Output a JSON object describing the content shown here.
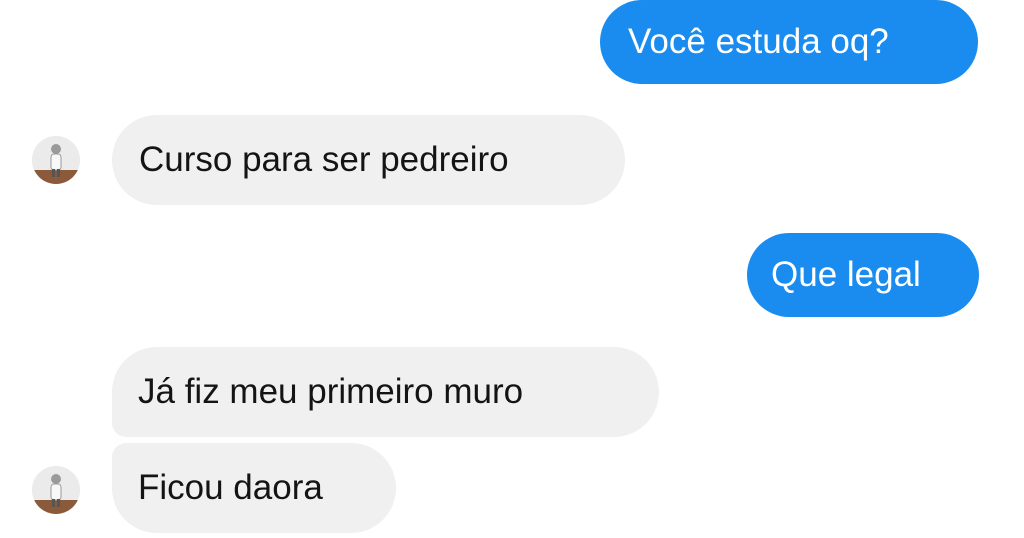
{
  "messages": [
    {
      "direction": "outgoing",
      "text": "Você estuda oq?"
    },
    {
      "direction": "incoming",
      "text": "Curso para ser pedreiro"
    },
    {
      "direction": "outgoing",
      "text": "Que legal"
    },
    {
      "direction": "incoming",
      "text": "Já fiz meu primeiro muro"
    },
    {
      "direction": "incoming",
      "text": "Ficou daora"
    }
  ],
  "colors": {
    "outgoing_bubble": "#1a8cf0",
    "incoming_bubble": "#f0f0f0",
    "background": "#ffffff"
  }
}
